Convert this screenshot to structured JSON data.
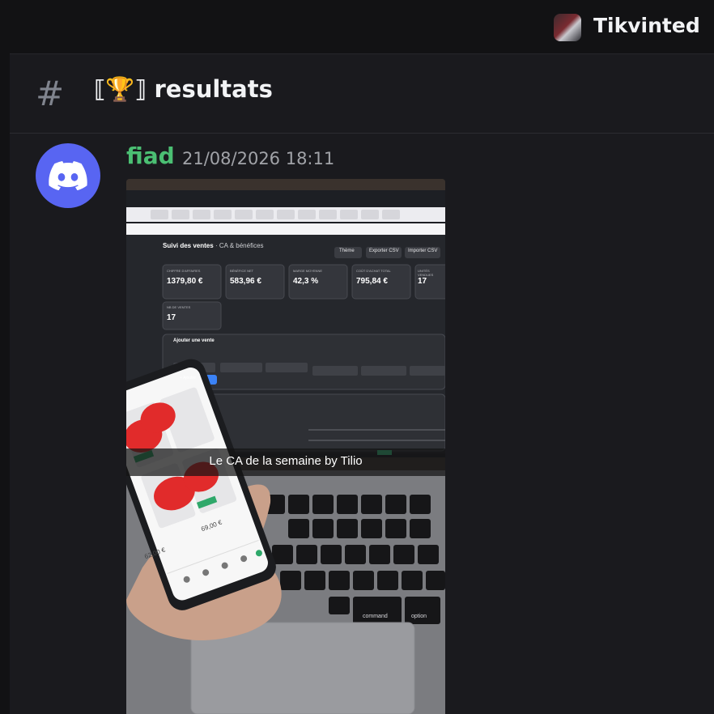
{
  "server": {
    "name": "Tikvinted"
  },
  "channel": {
    "name": "⟦🏆⟧ resultats"
  },
  "message": {
    "author": "fiad",
    "timestamp": "21/08/2026 18:11",
    "caption": "Le CA de la semaine by Tilio"
  },
  "photo_screen": {
    "title": "Suivi des ventes",
    "subtitle": "· CA & bénéfices",
    "buttons": [
      "Thème",
      "Exporter CSV",
      "Importer CSV"
    ],
    "kpis": [
      {
        "label": "CHIFFRE D'AFFAIRES",
        "value": "1379,80 €"
      },
      {
        "label": "BÉNÉFICE NET",
        "value": "583,96 €"
      },
      {
        "label": "MARGE MOYENNE",
        "value": "42,3 %"
      },
      {
        "label": "COÛT D'ACHAT TOTAL",
        "value": "795,84 €"
      },
      {
        "label": "UNITÉS VENDUES",
        "value": "17"
      },
      {
        "label": "NB DE VENTES",
        "value": "17"
      }
    ],
    "form_title": "Ajouter une vente",
    "add_button": "+ Ajouter",
    "phone_prices": [
      "69,00 €",
      "62,00 €"
    ],
    "keyboard_keys": [
      "command",
      "option"
    ]
  },
  "colors": {
    "accent": "#5865f2",
    "username": "#4bbf73"
  }
}
